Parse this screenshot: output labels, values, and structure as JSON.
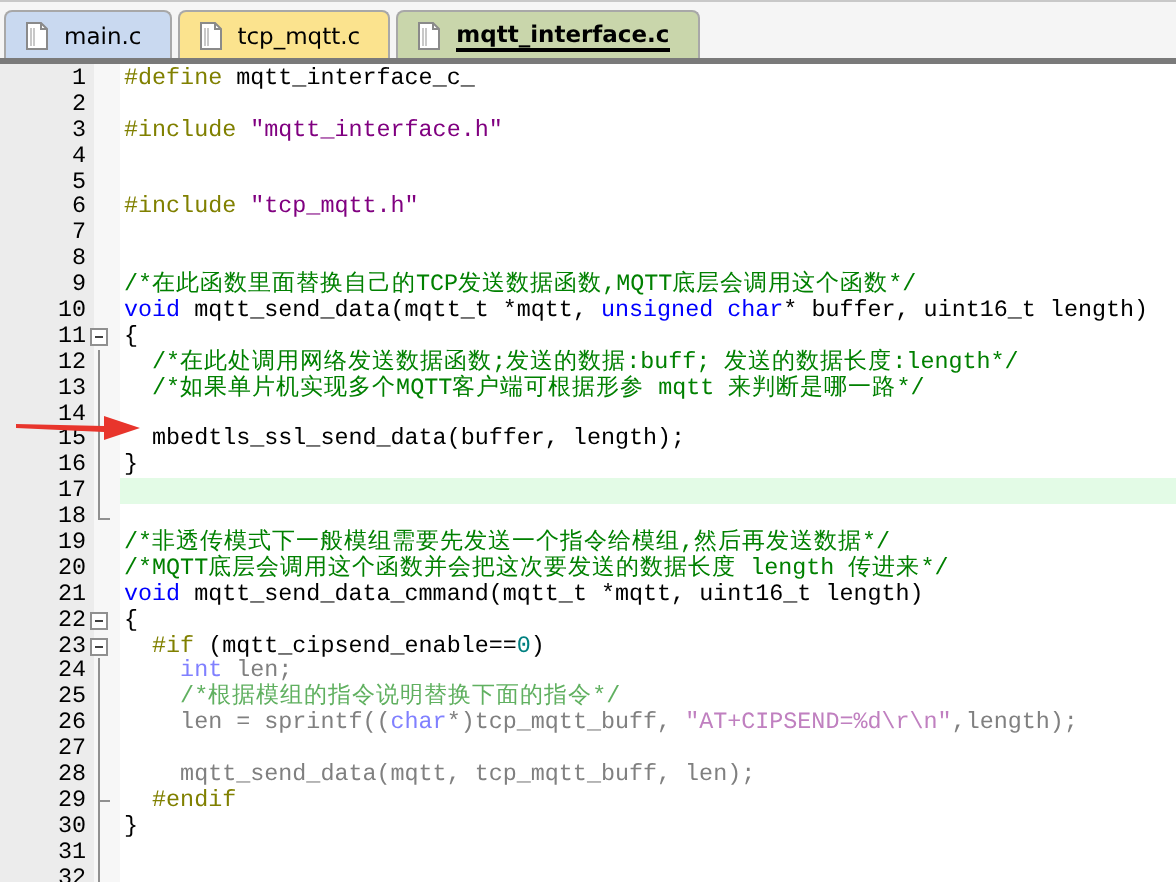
{
  "tabs": [
    {
      "label": "main.c",
      "selected": false,
      "color": "#c9d9f0"
    },
    {
      "label": "tcp_mqtt.c",
      "selected": false,
      "color": "#fbe38e"
    },
    {
      "label": "mqtt_interface.c",
      "selected": true,
      "color": "#c9d6ab"
    }
  ],
  "lines": [
    {
      "num": "1",
      "kind": "plain",
      "tokens": [
        {
          "kind": "pp",
          "text": "#define"
        },
        {
          "kind": "plain",
          "text": " mqtt_interface_c_"
        }
      ]
    },
    {
      "num": "2",
      "kind": "plain"
    },
    {
      "num": "3",
      "kind": "plain",
      "tokens": [
        {
          "kind": "pp",
          "text": "#include"
        },
        {
          "kind": "string",
          "text": " \"mqtt_interface.h\""
        }
      ]
    },
    {
      "num": "4",
      "kind": "plain"
    },
    {
      "num": "5",
      "kind": "plain"
    },
    {
      "num": "6",
      "kind": "plain",
      "tokens": [
        {
          "kind": "pp",
          "text": "#include"
        },
        {
          "kind": "string",
          "text": " \"tcp_mqtt.h\""
        }
      ]
    },
    {
      "num": "7",
      "kind": "plain"
    },
    {
      "num": "8",
      "kind": "plain"
    },
    {
      "num": "9",
      "kind": "plain",
      "tokens": [
        {
          "kind": "comment",
          "text": "/*在此函数里面替换自己的TCP发送数据函数,MQTT底层会调用这个函数*/"
        }
      ]
    },
    {
      "num": "10",
      "kind": "plain",
      "tokens": [
        {
          "kind": "keyword",
          "text": "void"
        },
        {
          "kind": "plain",
          "text": " mqtt_send_data(mqtt_t *mqtt, "
        },
        {
          "kind": "keyword",
          "text": "unsigned char"
        },
        {
          "kind": "plain",
          "text": "* buffer, uint16_t length)"
        }
      ]
    },
    {
      "num": "11",
      "kind": "open",
      "tokens": [
        {
          "kind": "plain",
          "text": "{"
        }
      ]
    },
    {
      "num": "12",
      "kind": "line",
      "tokens": [
        {
          "kind": "comment",
          "text": "  /*在此处调用网络发送数据函数;发送的数据:buff; 发送的数据长度:length*/"
        }
      ]
    },
    {
      "num": "13",
      "kind": "line",
      "tokens": [
        {
          "kind": "comment",
          "text": "  /*如果单片机实现多个MQTT客户端可根据形参 mqtt 来判断是哪一路*/"
        }
      ]
    },
    {
      "num": "14",
      "kind": "line"
    },
    {
      "num": "15",
      "kind": "line",
      "tokens": [
        {
          "kind": "plain",
          "text": "  mbedtls_ssl_send_data(buffer, length);"
        }
      ]
    },
    {
      "num": "16",
      "kind": "line",
      "tokens": [
        {
          "kind": "plain",
          "text": "}"
        }
      ]
    },
    {
      "num": "17",
      "kind": "line",
      "current": true
    },
    {
      "num": "18",
      "kind": "end"
    },
    {
      "num": "19",
      "kind": "plain",
      "tokens": [
        {
          "kind": "comment",
          "text": "/*非透传模式下一般模组需要先发送一个指令给模组,然后再发送数据*/"
        }
      ]
    },
    {
      "num": "20",
      "kind": "plain",
      "tokens": [
        {
          "kind": "comment",
          "text": "/*MQTT底层会调用这个函数并会把这次要发送的数据长度 length 传进来*/"
        }
      ]
    },
    {
      "num": "21",
      "kind": "plain",
      "tokens": [
        {
          "kind": "keyword",
          "text": "void"
        },
        {
          "kind": "plain",
          "text": " mqtt_send_data_cmmand(mqtt_t *mqtt, uint16_t length)"
        }
      ]
    },
    {
      "num": "22",
      "kind": "open",
      "tokens": [
        {
          "kind": "plain",
          "text": "{"
        }
      ]
    },
    {
      "num": "23",
      "kind": "open",
      "tokens": [
        {
          "kind": "pp",
          "text": "  #if"
        },
        {
          "kind": "plain",
          "text": " (mqtt_cipsend_enable=="
        },
        {
          "kind": "number",
          "text": "0"
        },
        {
          "kind": "plain",
          "text": ")"
        }
      ]
    },
    {
      "num": "24",
      "kind": "line",
      "inactive": true,
      "tokens": [
        {
          "kind": "keyword",
          "text": "    int"
        },
        {
          "kind": "plain",
          "text": " len;"
        }
      ]
    },
    {
      "num": "25",
      "kind": "line",
      "inactive": true,
      "tokens": [
        {
          "kind": "comment",
          "text": "    /*根据模组的指令说明替换下面的指令*/"
        }
      ]
    },
    {
      "num": "26",
      "kind": "line",
      "inactive": true,
      "tokens": [
        {
          "kind": "plain",
          "text": "    len = sprintf(("
        },
        {
          "kind": "keyword",
          "text": "char"
        },
        {
          "kind": "plain",
          "text": "*)tcp_mqtt_buff, "
        },
        {
          "kind": "string",
          "text": "\"AT+CIPSEND=%d\\r\\n\""
        },
        {
          "kind": "plain",
          "text": ",length);"
        }
      ]
    },
    {
      "num": "27",
      "kind": "line"
    },
    {
      "num": "28",
      "kind": "line",
      "inactive": true,
      "tokens": [
        {
          "kind": "plain",
          "text": "    mqtt_send_data(mqtt, tcp_mqtt_buff, len);"
        }
      ]
    },
    {
      "num": "29",
      "kind": "tick",
      "tokens": [
        {
          "kind": "pp",
          "text": "  #endif"
        }
      ]
    },
    {
      "num": "30",
      "kind": "line",
      "tokens": [
        {
          "kind": "plain",
          "text": "}"
        }
      ]
    },
    {
      "num": "31",
      "kind": "line"
    },
    {
      "num": "32",
      "kind": "line"
    }
  ]
}
